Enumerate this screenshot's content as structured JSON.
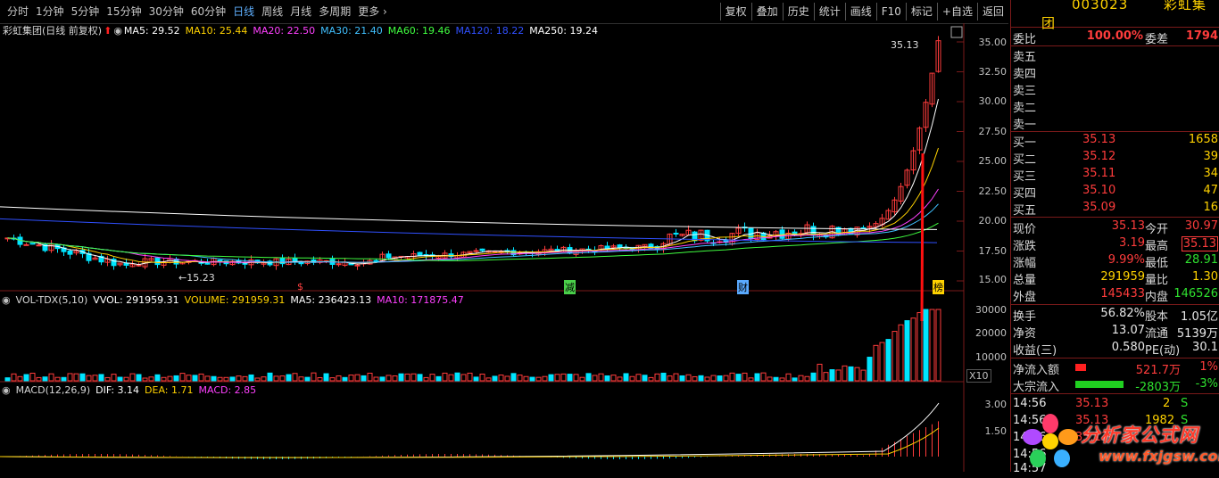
{
  "colors": {
    "up": "#ff3c3c",
    "down": "#00e5ff",
    "ma5": "#ffffff",
    "ma10": "#ffd200",
    "ma20": "#ff40ff",
    "ma30": "#40c0ff",
    "ma60": "#40ff40",
    "ma120": "#3050ff",
    "ma250": "#ffffff",
    "accent": "#5fb0ff"
  },
  "toolbar": {
    "periods": [
      "分时",
      "1分钟",
      "5分钟",
      "15分钟",
      "30分钟",
      "60分钟",
      "日线",
      "周线",
      "月线",
      "多周期",
      "更多"
    ],
    "active_period": "日线",
    "tools": [
      "复权",
      "叠加",
      "历史",
      "统计",
      "画线",
      "F10",
      "标记",
      "+自选",
      "返回"
    ]
  },
  "info": {
    "title": "彩虹集团(日线 前复权)",
    "ma5": "MA5: 29.52",
    "ma10": "MA10: 25.44",
    "ma20": "MA20: 22.50",
    "ma30": "MA30: 21.40",
    "ma60": "MA60: 19.46",
    "ma120": "MA120: 18.22",
    "ma250": "MA250: 19.24"
  },
  "price_axis": [
    "35.00",
    "32.50",
    "30.00",
    "27.50",
    "25.00",
    "22.50",
    "20.00",
    "17.50",
    "15.00"
  ],
  "annotations": {
    "high": "35.13",
    "low": "15.23",
    "markers": [
      "$",
      "减",
      "财",
      "榜"
    ]
  },
  "vol": {
    "title": "VOL-TDX(5,10)",
    "vvol": "VVOL: 291959.31",
    "volume": "VOLUME: 291959.31",
    "ma5": "MA5: 236423.13",
    "ma10": "MA10: 171875.47",
    "axis": [
      "30000",
      "20000",
      "10000"
    ],
    "scale": "X10"
  },
  "macd": {
    "title": "MACD(12,26,9)",
    "dif": "DIF: 3.14",
    "dea": "DEA: 1.71",
    "macd": "MACD: 2.85",
    "axis": [
      "3.00",
      "1.50"
    ]
  },
  "quote": {
    "code": "003023",
    "name": "彩虹集团",
    "webi_label": "委比",
    "webi": "100.00%",
    "weicha_label": "委差",
    "weicha": "1794",
    "sells": [
      {
        "label": "卖五"
      },
      {
        "label": "卖四"
      },
      {
        "label": "卖三"
      },
      {
        "label": "卖二"
      },
      {
        "label": "卖一"
      }
    ],
    "buys": [
      {
        "label": "买一",
        "price": "35.13",
        "vol": "1658"
      },
      {
        "label": "买二",
        "price": "35.12",
        "vol": "39"
      },
      {
        "label": "买三",
        "price": "35.11",
        "vol": "34"
      },
      {
        "label": "买四",
        "price": "35.10",
        "vol": "47"
      },
      {
        "label": "买五",
        "price": "35.09",
        "vol": "16"
      }
    ],
    "stats": [
      {
        "l1": "现价",
        "v1": "35.13",
        "l2": "今开",
        "v2": "30.97"
      },
      {
        "l1": "涨跌",
        "v1": "3.19",
        "l2": "最高",
        "v2": "35.13"
      },
      {
        "l1": "涨幅",
        "v1": "9.99%",
        "l2": "最低",
        "v2": "28.91"
      },
      {
        "l1": "总量",
        "v1": "291959",
        "l2": "量比",
        "v2": "1.30"
      },
      {
        "l1": "外盘",
        "v1": "145433",
        "l2": "内盘",
        "v2": "146526"
      }
    ],
    "fin": [
      {
        "l1": "换手",
        "v1": "56.82%",
        "l2": "股本",
        "v2": "1.05亿"
      },
      {
        "l1": "净资",
        "v1": "13.07",
        "l2": "流通",
        "v2": "5139万"
      },
      {
        "l1": "收益(三)",
        "v1": "0.580",
        "l2": "PE(动)",
        "v2": "30.1"
      }
    ],
    "flow": [
      {
        "label": "净流入额",
        "value": "521.7万",
        "pct": "1%"
      },
      {
        "label": "大宗流入",
        "value": "-2803万",
        "pct": "-3%"
      }
    ],
    "ticks": [
      {
        "time": "14:56",
        "price": "35.13",
        "vol": "2",
        "side": "S"
      },
      {
        "time": "14:56",
        "price": "35.13",
        "vol": "1982",
        "side": "S"
      },
      {
        "time": "14:56",
        "price": "35.13",
        "vol": "",
        "side": ""
      },
      {
        "time": "14:56",
        "price": "",
        "vol": "",
        "side": ""
      },
      {
        "time": "14:57",
        "price": "",
        "vol": "",
        "side": ""
      }
    ]
  },
  "watermark": {
    "text": "分析家公式网",
    "url": "www.fxjgsw.com"
  }
}
